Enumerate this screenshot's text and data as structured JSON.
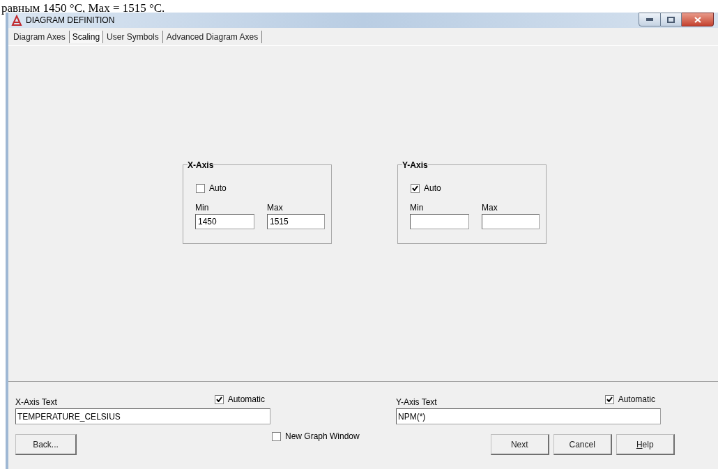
{
  "document_text": "равным 1450 °C, Max = 1515 °C.",
  "window": {
    "title": "DIAGRAM DEFINITION"
  },
  "tabs": [
    {
      "label": "Diagram Axes",
      "selected": false
    },
    {
      "label": "Scaling",
      "selected": true
    },
    {
      "label": "User Symbols",
      "selected": false
    },
    {
      "label": "Advanced Diagram Axes",
      "selected": false
    }
  ],
  "axis_groups": [
    {
      "title": "X-Axis",
      "auto_label": "Auto",
      "auto_checked": false,
      "min_label": "Min",
      "min_value": "1450",
      "max_label": "Max",
      "max_value": "1515"
    },
    {
      "title": "Y-Axis",
      "auto_label": "Auto",
      "auto_checked": true,
      "min_label": "Min",
      "max_label": "Max"
    }
  ],
  "axis_texts": [
    {
      "label": "X-Axis Text",
      "automatic_label": "Automatic",
      "automatic_checked": true,
      "value": "TEMPERATURE_CELSIUS"
    },
    {
      "label": "Y-Axis Text",
      "automatic_label": "Automatic",
      "automatic_checked": true,
      "value": "NPM(*)"
    }
  ],
  "back_button": "Back...",
  "new_graph_window": {
    "label": "New Graph Window",
    "checked": false
  },
  "buttons": [
    {
      "label": "Next",
      "underline_first": false
    },
    {
      "label": "Cancel",
      "underline_first": false
    },
    {
      "label": "Help",
      "underline_first": true
    }
  ]
}
